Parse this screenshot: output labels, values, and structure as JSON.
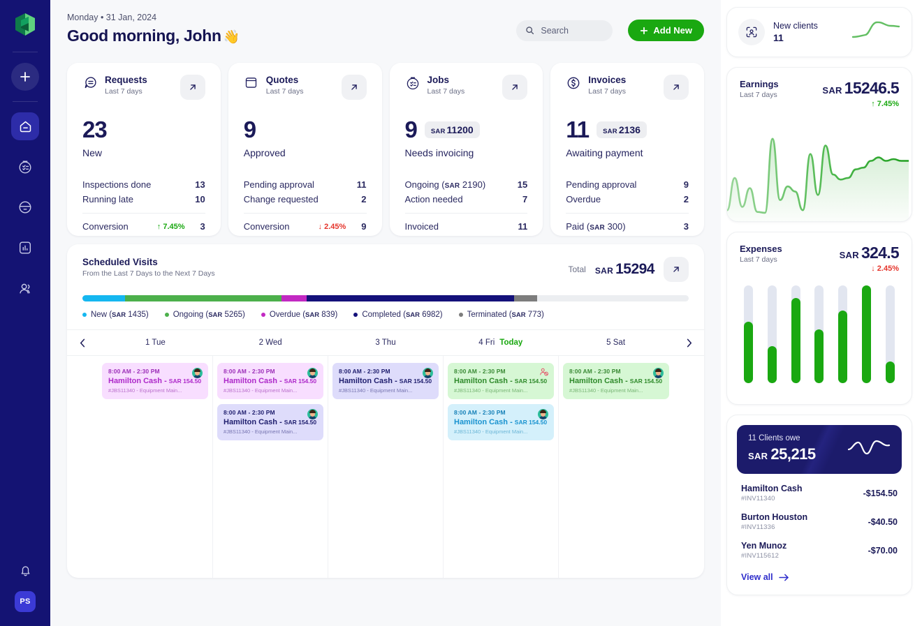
{
  "rail": {
    "logo": "cube-logo",
    "items": [
      {
        "name": "add",
        "icon": "plus-icon"
      },
      {
        "name": "home",
        "icon": "home-icon",
        "active": true
      },
      {
        "name": "jobs",
        "icon": "checklist-circle-icon"
      },
      {
        "name": "quotes",
        "icon": "minus-circle-icon"
      },
      {
        "name": "reports",
        "icon": "bar-chart-icon"
      },
      {
        "name": "clients",
        "icon": "users-icon"
      }
    ],
    "bell": "bell-icon",
    "avatar_initials": "PS"
  },
  "header": {
    "date": "Monday • 31 Jan, 2024",
    "greeting": "Good morning, John",
    "wave": "👋",
    "search_placeholder": "Search",
    "add_label": "Add New"
  },
  "stats": [
    {
      "icon": "request-chat-icon",
      "title": "Requests",
      "subtitle": "Last 7 days",
      "value": "23",
      "chip": null,
      "chip_currency": null,
      "label": "New",
      "rows": [
        {
          "label": "Inspections done",
          "value": "13"
        },
        {
          "label": "Running late",
          "value": "10"
        }
      ],
      "footer_label": "Conversion",
      "footer_delta": "↑ 7.45%",
      "footer_delta_dir": "up",
      "footer_value": "3"
    },
    {
      "icon": "quote-doc-icon",
      "title": "Quotes",
      "subtitle": "Last 7 days",
      "value": "9",
      "chip": null,
      "chip_currency": null,
      "label": "Approved",
      "rows": [
        {
          "label": "Pending approval",
          "value": "11"
        },
        {
          "label": "Change requested",
          "value": "2"
        }
      ],
      "footer_label": "Conversion",
      "footer_delta": "↓ 2.45%",
      "footer_delta_dir": "down",
      "footer_value": "9"
    },
    {
      "icon": "jobs-clock-icon",
      "title": "Jobs",
      "subtitle": "Last 7 days",
      "value": "9",
      "chip": "11200",
      "chip_currency": "SAR",
      "label": "Needs invoicing",
      "rows": [
        {
          "label": "Ongoing (SAR 2190)",
          "value": "15"
        },
        {
          "label": "Action needed",
          "value": "7"
        }
      ],
      "footer_label": "Invoiced",
      "footer_delta": null,
      "footer_delta_dir": null,
      "footer_value": "11"
    },
    {
      "icon": "invoice-dollar-icon",
      "title": "Invoices",
      "subtitle": "Last 7 days",
      "value": "11",
      "chip": "2136",
      "chip_currency": "SAR",
      "label": "Awaiting payment",
      "rows": [
        {
          "label": "Pending approval",
          "value": "9"
        },
        {
          "label": "Overdue",
          "value": "2"
        }
      ],
      "footer_label": "Paid (SAR 300)",
      "footer_delta": null,
      "footer_delta_dir": null,
      "footer_value": "3"
    }
  ],
  "scheduled": {
    "title": "Scheduled Visits",
    "subtitle": "From the Last 7 Days to the Next 7 Days",
    "total_label": "Total",
    "total_currency": "SAR",
    "total_value": "15294",
    "legend": [
      {
        "label": "New",
        "amount": "(SAR 1435)",
        "color": "#15b7f0",
        "pct": 9.4
      },
      {
        "label": "Ongoing",
        "amount": "(SAR 5265)",
        "color": "#4cb04b",
        "pct": 34.4
      },
      {
        "label": "Overdue",
        "amount": "(SAR 839)",
        "color": "#c229c2",
        "pct": 5.5
      },
      {
        "label": "Completed",
        "amount": "(SAR 6982)",
        "color": "#14117a",
        "pct": 45.6
      },
      {
        "label": "Terminated",
        "amount": "(SAR 773)",
        "color": "#7d7d7d",
        "pct": 5.1
      }
    ],
    "bar_filled_pct": 75
  },
  "calendar": {
    "prev": "chevron-left-icon",
    "next": "chevron-right-icon",
    "today_label": "Today",
    "days": [
      {
        "label": "1 Tue",
        "today": false
      },
      {
        "label": "2 Wed",
        "today": false
      },
      {
        "label": "3 Thu",
        "today": false
      },
      {
        "label": "4 Fri",
        "today": true
      },
      {
        "label": "5 Sat",
        "today": false
      }
    ],
    "events": [
      [
        {
          "time": "8:00 AM - 2:30 PM",
          "name": "Hamilton Cash",
          "sep": "-",
          "currency": "SAR",
          "amount": "154.50",
          "ref": "#JBS11340 - Equipment Main...",
          "color": "pink",
          "avatar": true,
          "off": false
        }
      ],
      [
        {
          "time": "8:00 AM - 2:30 PM",
          "name": "Hamilton Cash",
          "sep": "-",
          "currency": "SAR",
          "amount": "154.50",
          "ref": "#JBS11340 - Equipment Main...",
          "color": "pink",
          "avatar": true,
          "off": false
        },
        {
          "time": "8:00 AM - 2:30 PM",
          "name": "Hamilton Cash",
          "sep": "-",
          "currency": "SAR",
          "amount": "154.50",
          "ref": "#JBS11340 - Equipment Main...",
          "color": "purple",
          "avatar": true,
          "off": false
        }
      ],
      [
        {
          "time": "8:00 AM - 2:30 PM",
          "name": "Hamilton Cash",
          "sep": "-",
          "currency": "SAR",
          "amount": "154.50",
          "ref": "#JBS11340 - Equipment Main...",
          "color": "purple",
          "avatar": true,
          "off": false
        }
      ],
      [
        {
          "time": "8:00 AM - 2:30 PM",
          "name": "Hamilton Cash",
          "sep": "-",
          "currency": "SAR",
          "amount": "154.50",
          "ref": "#JBS11340 - Equipment Main...",
          "color": "green",
          "avatar": false,
          "off": true
        },
        {
          "time": "8:00 AM - 2:30 PM",
          "name": "Hamilton Cash",
          "sep": "-",
          "currency": "SAR",
          "amount": "154.50",
          "ref": "#JBS11340 - Equipment Main...",
          "color": "blue",
          "avatar": true,
          "off": false
        }
      ],
      [
        {
          "time": "8:00 AM - 2:30 PM",
          "name": "Hamilton Cash",
          "sep": "-",
          "currency": "SAR",
          "amount": "154.50",
          "ref": "#JBS11340 - Equipment Main...",
          "color": "green",
          "avatar": true,
          "off": false
        }
      ]
    ]
  },
  "right": {
    "new_clients": {
      "icon": "client-scan-icon",
      "label": "New clients",
      "value": "11"
    },
    "earnings": {
      "title": "Earnings",
      "subtitle": "Last 7 days",
      "currency": "SAR",
      "amount": "15246.5",
      "delta": "↑ 7.45%",
      "delta_dir": "up"
    },
    "expenses": {
      "title": "Expenses",
      "subtitle": "Last 7 days",
      "currency": "SAR",
      "amount": "324.5",
      "delta": "↓ 2.45%",
      "delta_dir": "down"
    },
    "owe": {
      "count_label": "11 Clients owe",
      "currency": "SAR",
      "amount": "25,215",
      "rows": [
        {
          "name": "Hamilton Cash",
          "invoice": "#INV11340",
          "value": "-$154.50"
        },
        {
          "name": "Burton Houston",
          "invoice": "#INV11336",
          "value": "-$40.50"
        },
        {
          "name": "Yen Munoz",
          "invoice": "#INV115612",
          "value": "-$70.00"
        }
      ],
      "view_all": "View all"
    }
  },
  "chart_data": [
    {
      "type": "bar",
      "name": "scheduled-visits-breakdown",
      "title": "Scheduled Visits",
      "categories": [
        "New",
        "Ongoing",
        "Overdue",
        "Completed",
        "Terminated"
      ],
      "values": [
        1435,
        5265,
        839,
        6982,
        773
      ],
      "total": 15294,
      "unit": "SAR",
      "colors": [
        "#15b7f0",
        "#4cb04b",
        "#c229c2",
        "#14117a",
        "#7d7d7d"
      ],
      "legend": "bottom",
      "grid": false
    },
    {
      "type": "area",
      "name": "earnings-sparkline",
      "title": "Earnings",
      "ylabel": "SAR",
      "x": [
        0,
        1,
        2,
        3,
        4,
        5,
        6,
        7,
        8,
        9,
        10,
        11,
        12,
        13,
        14,
        15,
        16,
        17,
        18,
        19,
        20,
        21,
        22,
        23,
        24
      ],
      "values": [
        8,
        46,
        12,
        34,
        6,
        5,
        92,
        20,
        36,
        30,
        8,
        74,
        26,
        84,
        50,
        44,
        46,
        56,
        58,
        66,
        70,
        66,
        68,
        66,
        66
      ],
      "ylim": [
        0,
        100
      ],
      "grid": false,
      "color": "#2aa82a"
    },
    {
      "type": "bar",
      "name": "expenses-bars",
      "title": "Expenses",
      "categories": [
        "1",
        "2",
        "3",
        "4",
        "5",
        "6",
        "7"
      ],
      "values": [
        63,
        38,
        87,
        55,
        74,
        100,
        22
      ],
      "track_values": [
        100,
        100,
        100,
        100,
        100,
        100,
        100
      ],
      "ylim": [
        0,
        100
      ],
      "unit": "SAR",
      "grid": false,
      "color": "#1aa811",
      "track_color": "#e2e6f0"
    },
    {
      "type": "line",
      "name": "clients-owe-sparkline",
      "title": "11 Clients owe",
      "x": [
        0,
        1,
        2,
        3,
        4,
        5,
        6,
        7,
        8
      ],
      "values": [
        40,
        38,
        52,
        70,
        44,
        22,
        46,
        72,
        62
      ],
      "ylim": [
        0,
        100
      ],
      "grid": false,
      "color": "#ffffff"
    },
    {
      "type": "line",
      "name": "new-clients-sparkline",
      "title": "New clients",
      "x": [
        0,
        1,
        2,
        3,
        4,
        5,
        6
      ],
      "values": [
        20,
        22,
        26,
        62,
        78,
        72,
        70
      ],
      "ylim": [
        0,
        100
      ],
      "grid": false,
      "color": "#63bf63"
    }
  ]
}
